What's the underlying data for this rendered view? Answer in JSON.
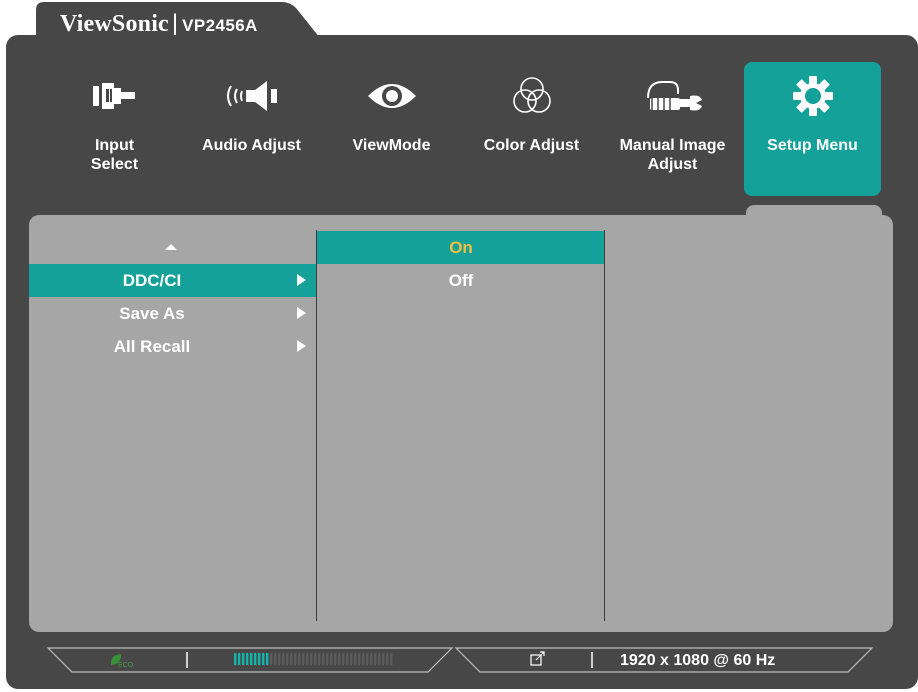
{
  "brand": {
    "name": "ViewSonic",
    "separator": "|",
    "model": "VP2456A"
  },
  "menu": {
    "items": [
      {
        "label": "Input\nSelect",
        "icon": "input-select-icon",
        "active": false
      },
      {
        "label": "Audio Adjust",
        "icon": "audio-speaker-icon",
        "active": false
      },
      {
        "label": "ViewMode",
        "icon": "eye-icon",
        "active": false
      },
      {
        "label": "Color Adjust",
        "icon": "color-circles-icon",
        "active": false
      },
      {
        "label": "Manual Image\nAdjust",
        "icon": "hand-wrench-icon",
        "active": false
      },
      {
        "label": "Setup Menu",
        "icon": "gear-icon",
        "active": true
      }
    ]
  },
  "submenu": {
    "options": [
      {
        "label": "DDC/CI",
        "selected": true
      },
      {
        "label": "Save As",
        "selected": false
      },
      {
        "label": "All Recall",
        "selected": false
      }
    ]
  },
  "values": {
    "options": [
      {
        "label": "On",
        "selected": true
      },
      {
        "label": "Off",
        "selected": false
      }
    ]
  },
  "status": {
    "eco_icon": "eco-leaf-icon",
    "eco_text": "ECO",
    "brightness_level": 0.22,
    "link_icon": "external-link-icon",
    "resolution": "1920 x 1080 @ 60 Hz"
  },
  "colors": {
    "accent": "#14a19a",
    "frame": "#474747",
    "panel": "#a6a6a6",
    "selected_value": "#f0c040"
  }
}
